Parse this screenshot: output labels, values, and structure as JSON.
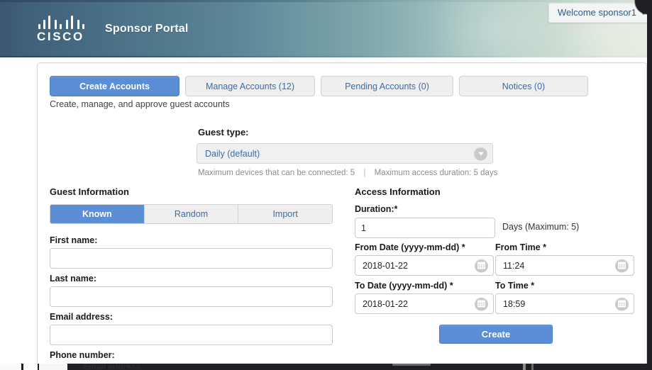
{
  "header": {
    "brand": "CISCO",
    "portal_title": "Sponsor Portal",
    "welcome_text": "Welcome sponsor1"
  },
  "tabs": [
    {
      "label": "Create Accounts",
      "active": true
    },
    {
      "label": "Manage Accounts (12)",
      "active": false
    },
    {
      "label": "Pending Accounts (0)",
      "active": false
    },
    {
      "label": "Notices (0)",
      "active": false
    }
  ],
  "subtitle": "Create, manage, and approve guest accounts",
  "guest_type": {
    "label": "Guest type:",
    "selected": "Daily (default)",
    "note_devices": "Maximum devices that can be connected: 5",
    "note_separator": "|",
    "note_duration": "Maximum access duration: 5 days"
  },
  "guest_information": {
    "heading": "Guest Information",
    "modes": [
      {
        "label": "Known",
        "active": true
      },
      {
        "label": "Random",
        "active": false
      },
      {
        "label": "Import",
        "active": false
      }
    ],
    "fields": {
      "first_name_label": "First name:",
      "first_name_value": "",
      "last_name_label": "Last name:",
      "last_name_value": "",
      "email_label": "Email address:",
      "email_value": "",
      "phone_label": "Phone number:"
    }
  },
  "access_information": {
    "heading": "Access Information",
    "duration_label": "Duration:*",
    "duration_value": "1",
    "duration_note": "Days (Maximum: 5)",
    "from_date_label": "From Date (yyyy-mm-dd) *",
    "from_date_value": "2018-01-22",
    "from_time_label": "From Time *",
    "from_time_value": "11:24",
    "to_date_label": "To Date (yyyy-mm-dd) *",
    "to_date_value": "2018-01-22",
    "to_time_label": "To Time *",
    "to_time_value": "18:59",
    "create_button": "Create"
  },
  "overflow_strip": {
    "ghost_text": "Email address:"
  },
  "colors": {
    "accent_blue": "#5b8ed4",
    "link_blue": "#3c6ca8",
    "banner_dark": "#3c5771",
    "banner_light": "#e8eddf"
  }
}
